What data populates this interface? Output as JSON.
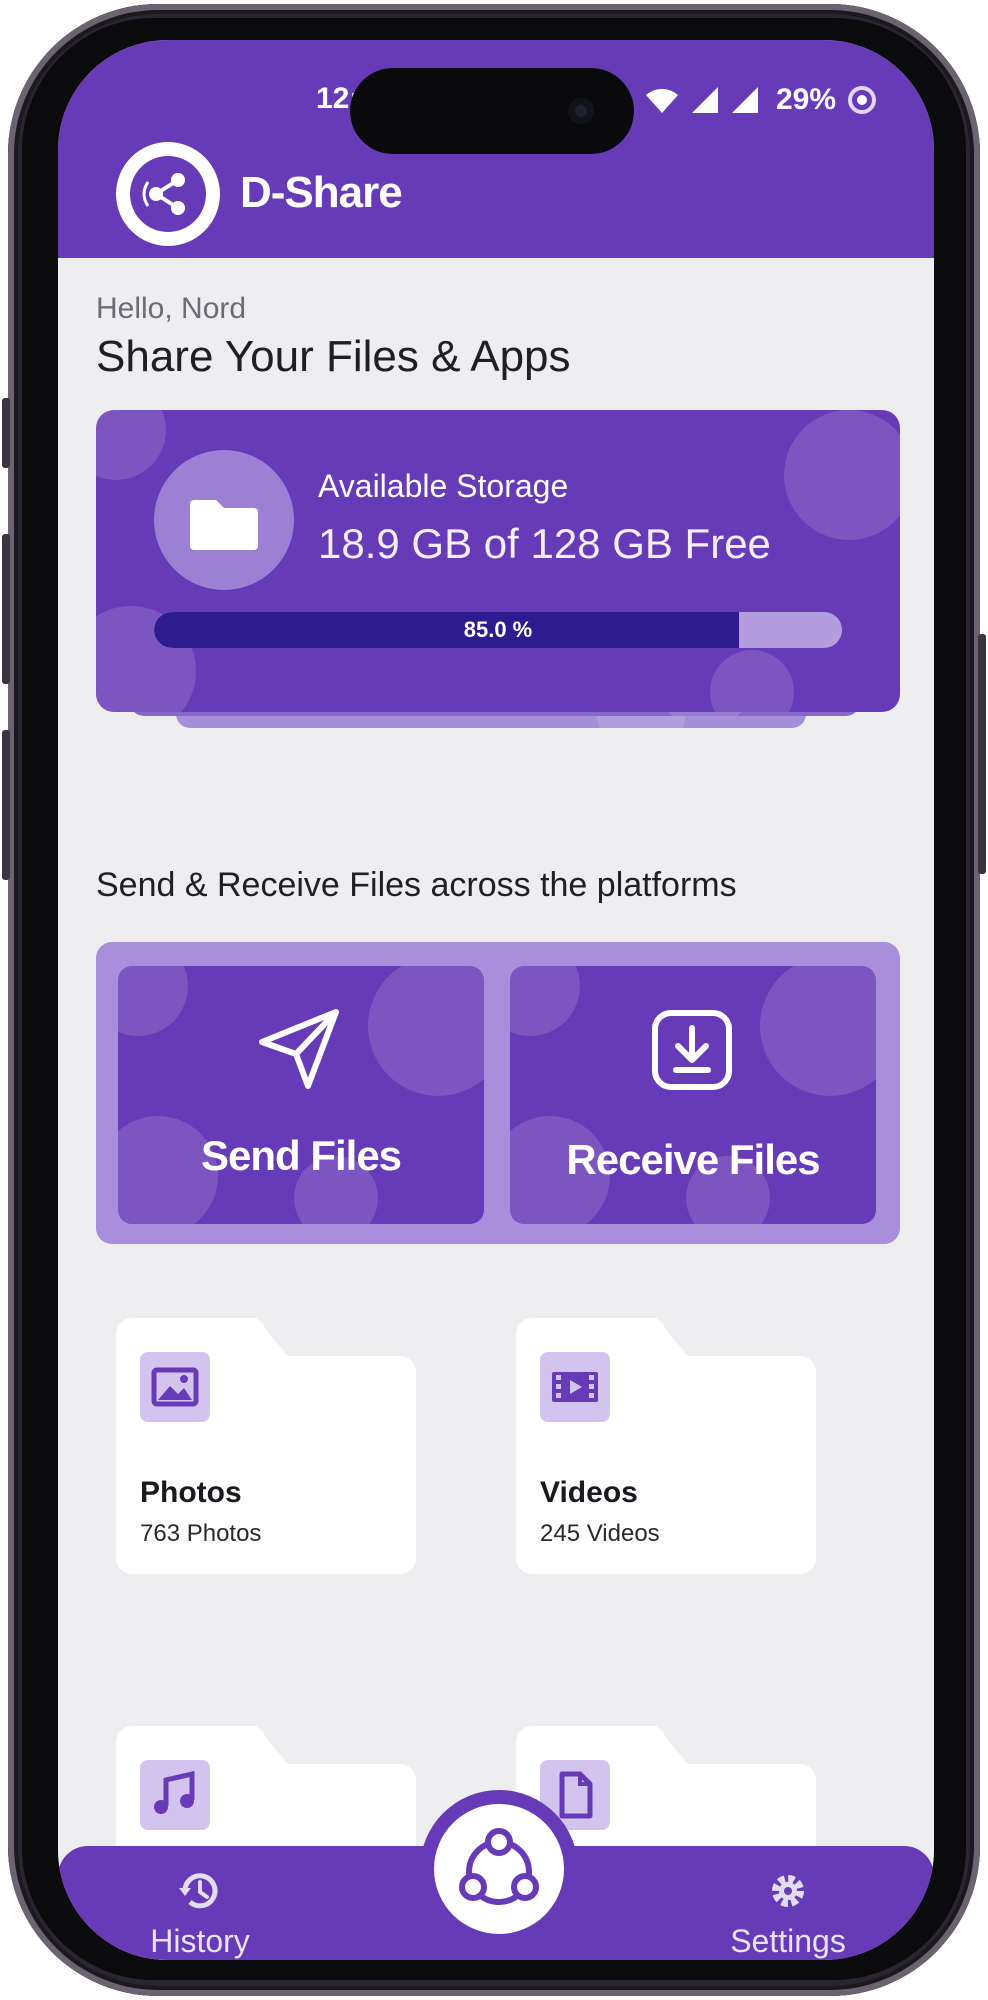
{
  "status_bar": {
    "time": "12:",
    "battery_percent": "29%"
  },
  "app": {
    "title": "D-Share"
  },
  "greeting": "Hello, Nord",
  "headline": "Share Your Files & Apps",
  "storage": {
    "label": "Available Storage",
    "value": "18.9 GB of 128 GB Free",
    "used_percent_label": "85.0 %",
    "used_fraction": 0.85
  },
  "section_caption": "Send & Receive Files across the platforms",
  "actions": {
    "send_label": "Send Files",
    "receive_label": "Receive Files"
  },
  "categories": [
    {
      "title": "Photos",
      "count": "763 Photos",
      "icon": "image-icon"
    },
    {
      "title": "Videos",
      "count": "245 Videos",
      "icon": "film-icon"
    },
    {
      "title": "",
      "count": "",
      "icon": "music-note-icon"
    },
    {
      "title": "",
      "count": "",
      "icon": "document-icon"
    }
  ],
  "bottom_nav": {
    "history_label": "History",
    "settings_label": "Settings",
    "center_icon": "share-icon"
  },
  "colors": {
    "primary": "#673ab7",
    "primary_light": "#a98fdb",
    "progress_fill": "#2e1b8f",
    "background": "#eeedf0"
  }
}
